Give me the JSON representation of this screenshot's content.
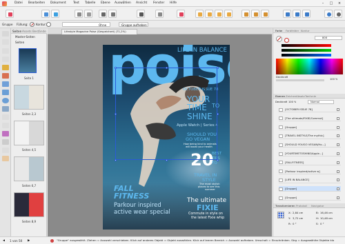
{
  "menu": [
    "Datei",
    "Bearbeiten",
    "Dokument",
    "Text",
    "Tabelle",
    "Ebene",
    "Auswählen",
    "Ansicht",
    "Fenster",
    "Hilfe"
  ],
  "context": {
    "gruppe": "Gruppe",
    "fuellung": "Füllung:",
    "kontur": "Kontur:",
    "ohne": "Ohne",
    "gruppe_aufheben": "Gruppe aufheben"
  },
  "pages": {
    "tab1": "Seiten",
    "tab2": "Assets",
    "tab3": "Bestände",
    "master": "Master-Seiten",
    "seiten": "Seiten",
    "thumbs": [
      "Seite 1",
      "Seiten 2,3",
      "Seiten 4,5",
      "Seiten 6,7",
      "Seiten 8,9"
    ]
  },
  "document_tab": "Lifestyle Magazine Poise (Gespeichert) (71,2%)",
  "magazine": {
    "life_in_balance": "LIFE IN BALANCE",
    "masthead": "poise",
    "issue": "OCTOBER ISSUE 78",
    "your_time_to_shine": [
      "YOUR",
      "TIME",
      "TO",
      "SHINE"
    ],
    "apple_watch": "Apple Watch | Series 4",
    "should_you": [
      "SHOULD YOU",
      "GO VEGAN"
    ],
    "vegan_sub": [
      "How being kind to animals",
      "will boost your health"
    ],
    "big_number": "20",
    "tips": [
      "BEST",
      "TIPS",
      "TO"
    ],
    "travel": [
      "TRAVEL IN",
      "STYLE"
    ],
    "travel_sub": [
      "The most stylish",
      "places to see this",
      "summer"
    ],
    "fall": "FALL",
    "fitness": "FITNESS",
    "parkour": [
      "Parkour inspired",
      "active wear special"
    ],
    "ultimate": [
      "The ultimate",
      "FIXIE"
    ],
    "commute": [
      "Commute in style on",
      "the latest Fixie whip"
    ]
  },
  "right": {
    "tabs": [
      "Farbe",
      "Farbfelder",
      "Kontur"
    ],
    "opacity_label": "Deckkraft",
    "opacity_value": "100 %",
    "hex_value": "808",
    "layers_tabs": [
      "Ebenen",
      "Zeichen",
      "Absatz",
      "Tanfunle"
    ],
    "blend_label": "Deckkraft",
    "blend_value": "100 %",
    "blend_mode": "Normal",
    "layers": [
      "[OCTOBER ISSUE 78]",
      "[The ultimate/FIXIE/Commut]",
      "[Gruppe]",
      "[TRAVEL INSTYLE/The mythic]",
      "[SHOULD YOUGO VEGAN/Ho...]",
      "[YOURTIMETOSHINE/Apple...]",
      "[FALLFITNESS]",
      "[Parkour inspired/active w]",
      "[LIFE IN BALANCE]",
      "[Gruppe]",
      "[Gruppe]"
    ],
    "transform_tabs": [
      "Transformieren",
      "Protokoll",
      "Navigator"
    ],
    "transform": {
      "x_label": "X:",
      "x_val": "2,84 cm",
      "y_label": "Y:",
      "y_val": "3,72 cm",
      "b_label": "B:",
      "b_val": "16,46 cm",
      "h_label": "H:",
      "h_val": "10,48 cm",
      "r_label": "R:",
      "r_val": "0 °",
      "s_label": "S:",
      "s_val": "0 °"
    }
  },
  "status": {
    "page": "1 von 50",
    "message": "\"Gruppe\" ausgewählt. Ziehen = Auswahl verschieben. Klick auf anderes Objekt = Objekt auswählen. Klick auf leeren Bereich = Auswahl aufheben. Umschalt = Einschränken. Strg = Ausgewählte Objekte klo"
  },
  "colors": {
    "accent_blue": "#5db8ef",
    "selection": "#2a5bd7",
    "fill_red": "#c9302c"
  }
}
